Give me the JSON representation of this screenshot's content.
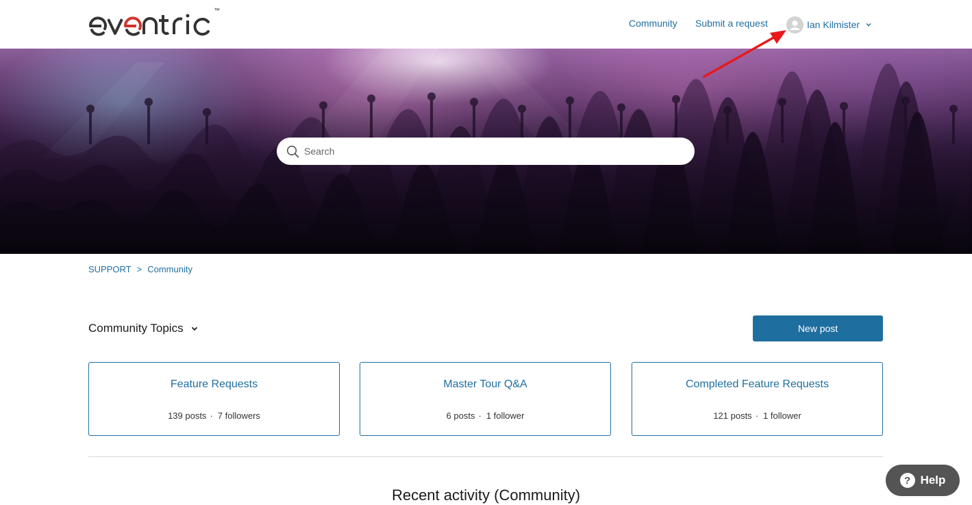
{
  "brand": {
    "logo_text": "eventric",
    "trademark": "™",
    "logo_color": "#333333",
    "logo_accent_color": "#d0342c"
  },
  "header": {
    "nav": {
      "community": "Community",
      "submit_request": "Submit a request"
    },
    "user": {
      "name": "Ian Kilmister"
    }
  },
  "hero": {
    "search": {
      "placeholder": "Search"
    }
  },
  "breadcrumb": {
    "items": [
      "SUPPORT",
      "Community"
    ],
    "separator": ">"
  },
  "topics": {
    "title": "Community Topics",
    "new_post_label": "New post",
    "cards": [
      {
        "title": "Feature Requests",
        "posts": "139 posts",
        "followers": "7 followers"
      },
      {
        "title": "Master Tour Q&A",
        "posts": "6 posts",
        "followers": "1 follower"
      },
      {
        "title": "Completed Feature Requests",
        "posts": "121 posts",
        "followers": "1 follower"
      }
    ],
    "meta_separator": "·"
  },
  "recent": {
    "title": "Recent activity (Community)"
  },
  "help_widget": {
    "icon": "?",
    "label": "Help"
  },
  "colors": {
    "accent": "#1f6ea0",
    "annotation_arrow": "#e8191b",
    "help_bg": "#545454"
  },
  "icons": [
    "search-icon",
    "user-avatar-icon",
    "chevron-down-icon",
    "help-icon"
  ]
}
